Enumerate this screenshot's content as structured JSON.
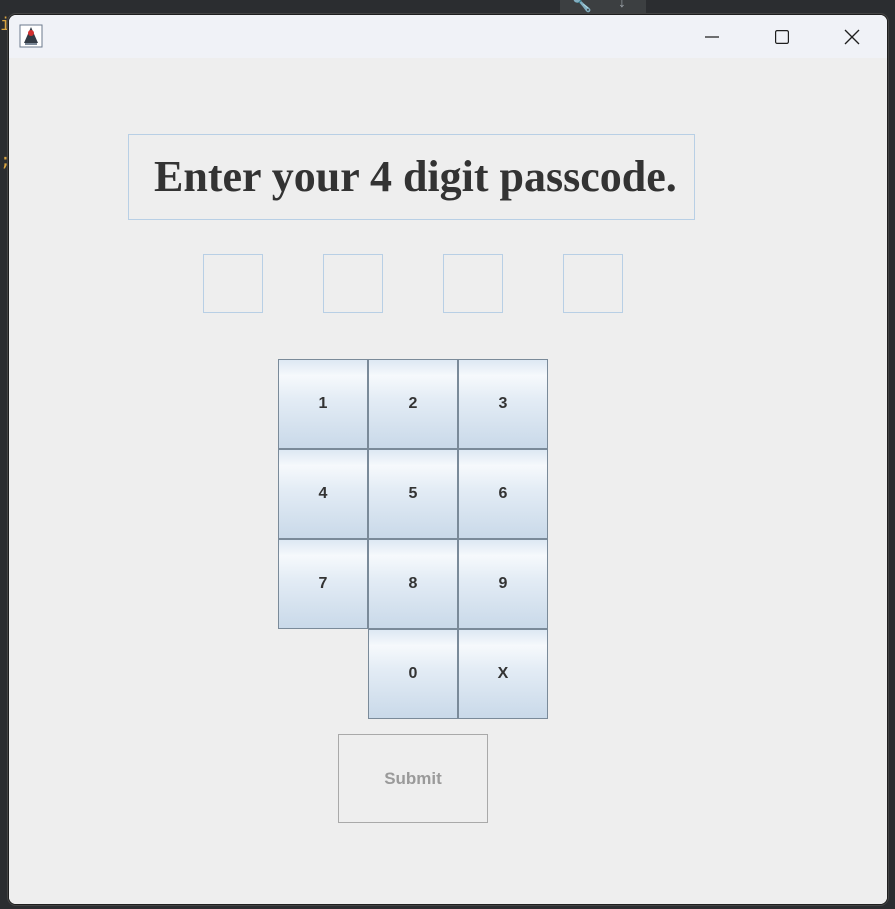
{
  "window": {
    "app_icon": "java-duke-icon",
    "controls": {
      "minimize_icon": "minimize-icon",
      "maximize_icon": "maximize-icon",
      "close_icon": "close-icon"
    }
  },
  "main": {
    "prompt": "Enter your 4 digit passcode.",
    "digits": [
      "",
      "",
      "",
      ""
    ],
    "keypad": {
      "row1": [
        "1",
        "2",
        "3"
      ],
      "row2": [
        "4",
        "5",
        "6"
      ],
      "row3": [
        "7",
        "8",
        "9"
      ],
      "row4": [
        "0",
        "X"
      ]
    },
    "submit_label": "Submit"
  },
  "colors": {
    "window_bg": "#eeeeee",
    "titlebar_bg": "#f0f2f7",
    "field_border": "#b8cfe5",
    "key_text": "#333333",
    "disabled_text": "#9a9a9a"
  }
}
